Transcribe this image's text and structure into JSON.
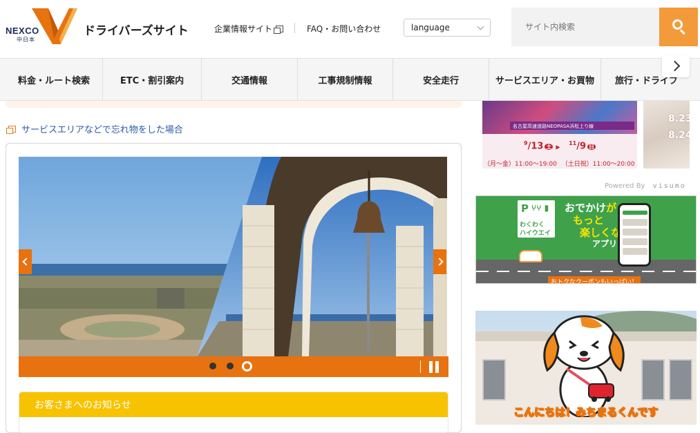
{
  "header": {
    "logo_text": "NEXCO",
    "logo_sub": "中日本",
    "site_title": "ドライバーズサイト",
    "corp_link": "企業情報サイト",
    "faq_link": "FAQ・お問い合わせ",
    "language_label": "language",
    "search_placeholder": "サイト内検索"
  },
  "nav": {
    "items": [
      {
        "label": "料金・ルート検索"
      },
      {
        "label": "ETC・割引案内"
      },
      {
        "label": "交通情報"
      },
      {
        "label": "工事規制情報"
      },
      {
        "label": "安全走行"
      },
      {
        "label": "サービスエリア・お買物"
      },
      {
        "label": "旅行・ドライブ"
      }
    ]
  },
  "main": {
    "lost_item_link": "サービスエリアなどで忘れ物をした場合",
    "slider": {
      "dot_count": 3,
      "active_dot": 3
    },
    "notice_title": "お客さまへのお知らせ"
  },
  "sidebar": {
    "event_banner": {
      "small_text": "名古屋高速道路NEOPASA浜松上り線",
      "start_month": "9",
      "start_day": "13",
      "start_dow": "土",
      "end_month": "11",
      "end_day": "9",
      "end_dow": "日",
      "hours_weekday": "（月〜金）11:00〜19:00",
      "hours_weekend": "（土日祝）11:00〜20:00"
    },
    "crystal_banner": {
      "line1": "8.23",
      "line2": "8.24"
    },
    "powered_by_label": "Powered By",
    "powered_by_brand": "visumo",
    "app_banner": {
      "logo_top": "P",
      "logo_line1": "わくわく",
      "logo_line2": "ハイウエイ",
      "line1_a": "おでかけ",
      "line1_b": "が",
      "line2": "もっと",
      "line3_a": "楽しくなる",
      "line3_b": "",
      "line4": "アプリ",
      "coupon": "おトクなクーポンもいっぱい！"
    },
    "mascot_banner": {
      "caption": "こんにちは！みちまるくんです"
    }
  },
  "colors": {
    "accent_orange": "#e8720f",
    "search_orange": "#f39a3a",
    "notice_yellow": "#f7c200",
    "link_blue": "#2a5aa8"
  }
}
